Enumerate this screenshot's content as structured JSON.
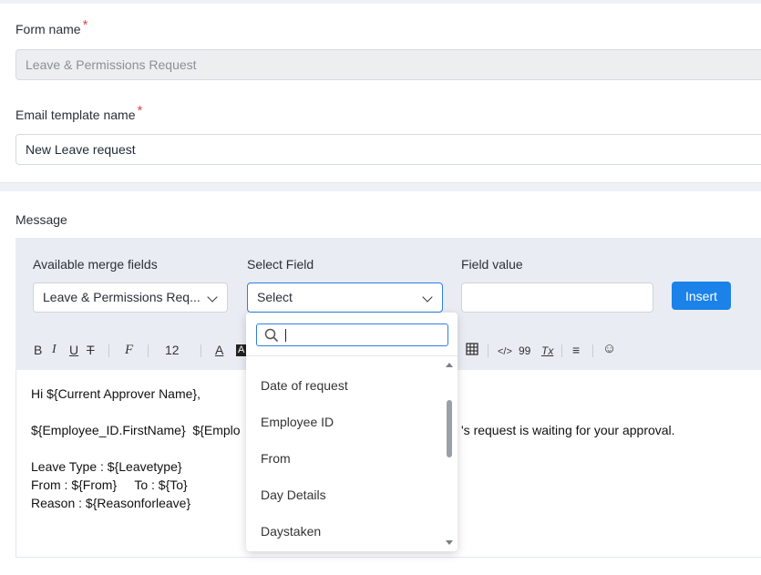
{
  "form": {
    "form_name_label": "Form name",
    "form_name_value": "Leave & Permissions Request",
    "email_template_label": "Email template name",
    "email_template_value": "New Leave request",
    "required_mark": "*"
  },
  "message": {
    "label": "Message",
    "available_merge_fields_label": "Available merge fields",
    "available_merge_fields_value": "Leave & Permissions Req...",
    "select_field_label": "Select Field",
    "select_field_value": "Select",
    "field_value_label": "Field value",
    "field_value_value": "",
    "insert_button": "Insert"
  },
  "toolbar": {
    "bold": "B",
    "italic": "I",
    "underline": "U",
    "strike": "T",
    "font_icon": "F",
    "font_size": "12",
    "font_color": "A",
    "bg_color": "A",
    "code": "</>",
    "quote": "99",
    "clear": "Tx",
    "hr": "≡",
    "emoji": "☺"
  },
  "editor": {
    "line1": "Hi ${Current Approver Name},",
    "line2a": "${Employee_ID.FirstName}  ${Emplo",
    "line2b": "'s request is waiting for your approval.",
    "line3": "Leave Type : ${Leavetype}",
    "line4": "From : ${From}     To : ${To}",
    "line5": "Reason : ${Reasonforleave}"
  },
  "dropdown": {
    "search_value": "",
    "items": [
      "Date of request",
      "Employee ID",
      "From",
      "Day Details",
      "Daystaken"
    ]
  }
}
